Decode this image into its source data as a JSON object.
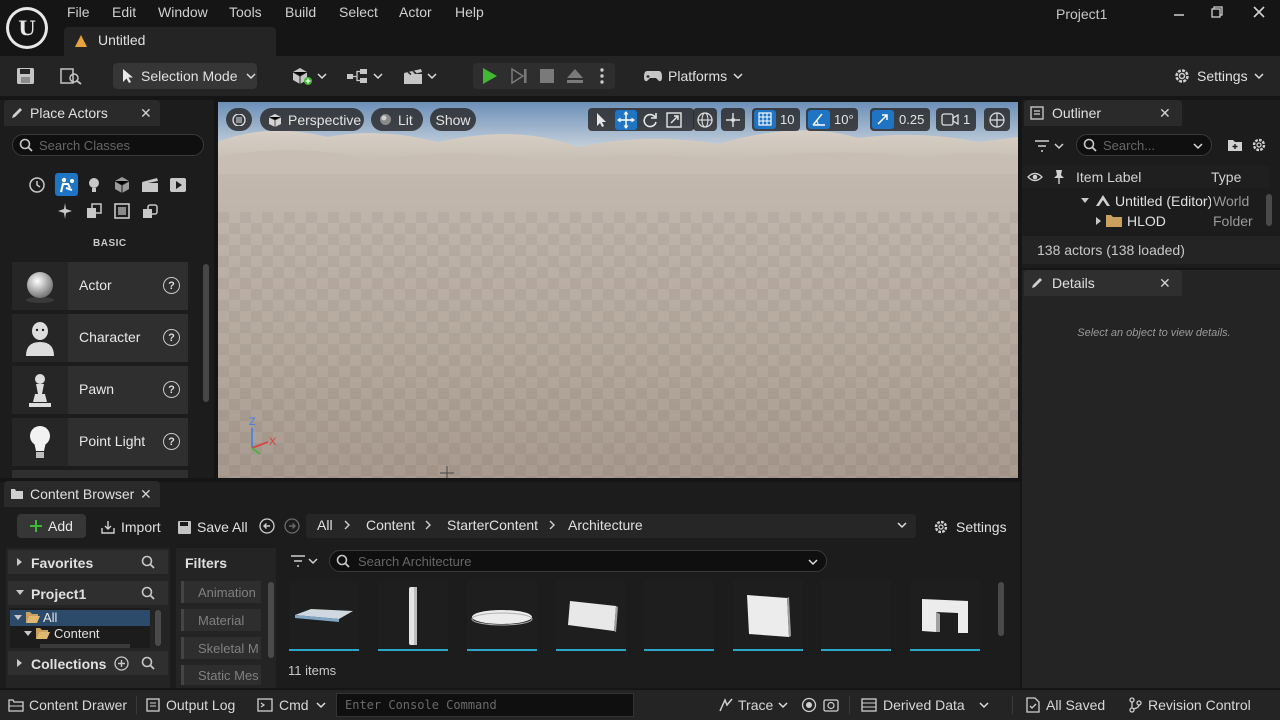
{
  "window": {
    "project_name": "Project1",
    "menu": [
      "File",
      "Edit",
      "Window",
      "Tools",
      "Build",
      "Select",
      "Actor",
      "Help"
    ],
    "level_tab": "Untitled"
  },
  "toolbar": {
    "selection_mode": "Selection Mode",
    "platforms": "Platforms",
    "settings": "Settings"
  },
  "place_actors": {
    "tab_label": "Place Actors",
    "search_placeholder": "Search Classes",
    "category_heading": "BASIC",
    "items": [
      {
        "label": "Actor",
        "icon": "sphere-icon"
      },
      {
        "label": "Character",
        "icon": "character-icon"
      },
      {
        "label": "Pawn",
        "icon": "pawn-icon"
      },
      {
        "label": "Point Light",
        "icon": "bulb-icon"
      }
    ]
  },
  "viewport": {
    "perspective": "Perspective",
    "lit": "Lit",
    "show": "Show",
    "grid_snap": "10",
    "rotation_snap": "10°",
    "scale_snap": "0.25",
    "camera_speed": "1",
    "axis": {
      "z": "Z",
      "x": "X"
    }
  },
  "outliner": {
    "tab_label": "Outliner",
    "search_placeholder": "Search...",
    "col_label": "Item Label",
    "col_type": "Type",
    "rows": [
      {
        "label": "Untitled (Editor)",
        "type": "World"
      },
      {
        "label": "HLOD",
        "type": "Folder"
      }
    ],
    "actor_count": "138 actors (138 loaded)"
  },
  "details": {
    "tab_label": "Details",
    "empty_hint": "Select an object to view details."
  },
  "content_browser": {
    "tab_label": "Content Browser",
    "add": "Add",
    "import": "Import",
    "save_all": "Save All",
    "path": [
      "All",
      "Content",
      "StarterContent",
      "Architecture"
    ],
    "settings": "Settings",
    "favorites": "Favorites",
    "project": "Project1",
    "tree": {
      "all": "All",
      "content": "Content"
    },
    "collections": "Collections",
    "filters_heading": "Filters",
    "filters": [
      "Animation",
      "Material",
      "Skeletal M",
      "Static Mes"
    ],
    "search_placeholder": "Search Architecture",
    "item_count": "11 items"
  },
  "status_bar": {
    "content_drawer": "Content Drawer",
    "output_log": "Output Log",
    "cmd": "Cmd",
    "console_placeholder": "Enter Console Command",
    "trace": "Trace",
    "derived_data": "Derived Data",
    "all_saved": "All Saved",
    "revision_control": "Revision Control"
  },
  "colors": {
    "accent_blue": "#2a8fd9",
    "play_green": "#3fb832",
    "panel_bg": "#242424",
    "dark_bg": "#151515",
    "warning_orange": "#e8a23a"
  }
}
